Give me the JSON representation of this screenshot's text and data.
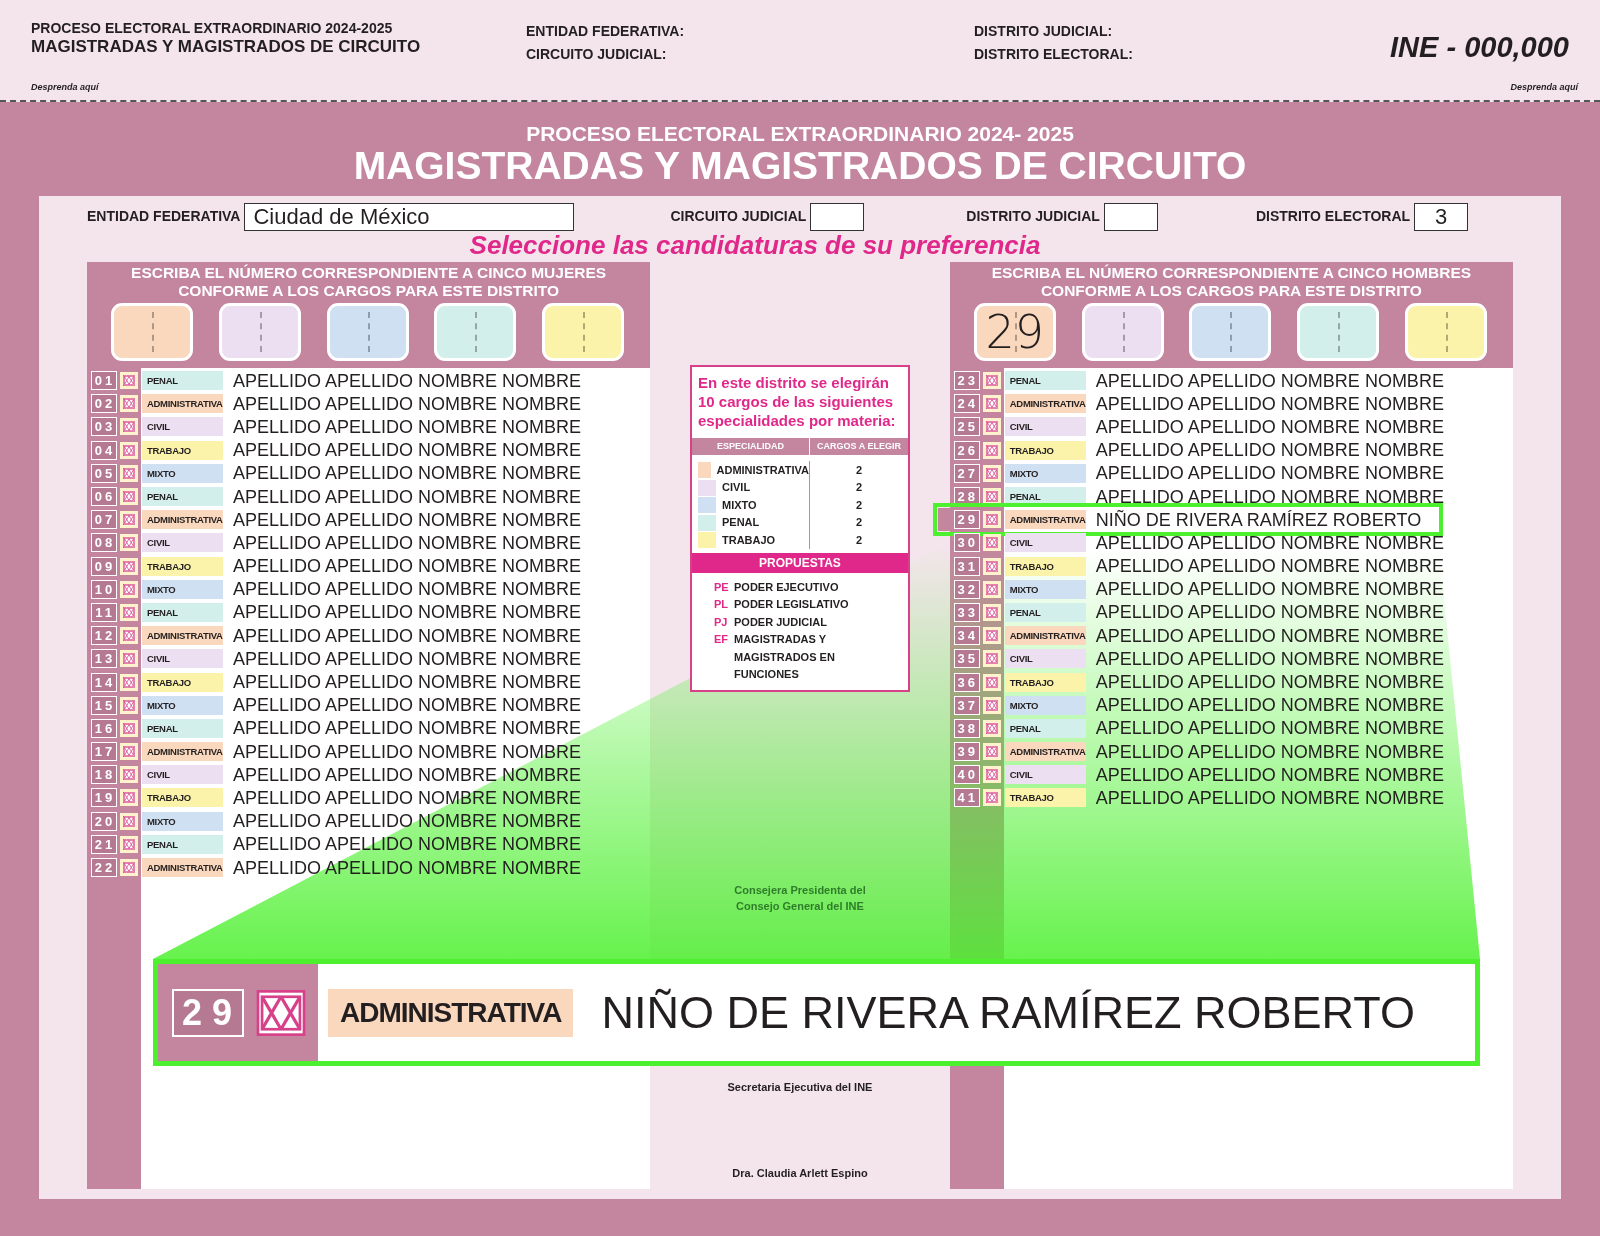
{
  "stub": {
    "election": "PROCESO ELECTORAL EXTRAORDINARIO 2024-2025",
    "title": "MAGISTRADAS Y MAGISTRADOS DE CIRCUITO",
    "detach_left": "Desprenda aquí",
    "labels": [
      "ENTIDAD FEDERATIVA:",
      "CIRCUITO JUDICIAL:",
      "DISTRITO JUDICIAL:",
      "DISTRITO ELECTORAL:"
    ],
    "folio": "INE - 000,000",
    "detach_right": "Desprenda aquí"
  },
  "ballot": {
    "election": "PROCESO ELECTORAL EXTRAORDINARIO 2024- 2025",
    "title": "MAGISTRADAS Y MAGISTRADOS DE CIRCUITO"
  },
  "fields": [
    {
      "label": "ENTIDAD FEDERATIVA",
      "value": "Ciudad de México"
    },
    {
      "label": "CIRCUITO JUDICIAL"
    },
    {
      "label": "DISTRITO JUDICIAL"
    },
    {
      "label": "DISTRITO ELECTORAL",
      "value": "3"
    }
  ],
  "instruction": "Seleccione las candidaturas de su preferencia",
  "panels": [
    {
      "heading": [
        "ESCRIBA EL NÚMERO CORRESPONDIENTE A CINCO MUJERES",
        "CONFORME A LOS CARGOS PARA ESTE DISTRITO"
      ],
      "boxes": [
        {
          "color": "#f9d8bd"
        },
        {
          "color": "#ecdff1"
        },
        {
          "color": "#cfe0f3"
        },
        {
          "color": "#d3efec"
        },
        {
          "color": "#fbf3a9"
        }
      ],
      "rows": [
        {
          "number": "01",
          "specialty": "PENAL",
          "color": "#d3efec",
          "name": "APELLIDO APELLIDO NOMBRE NOMBRE",
          "selected": false
        },
        {
          "number": "02",
          "specialty": "ADMINISTRATIVA",
          "color": "#f9d8bd",
          "name": "APELLIDO APELLIDO NOMBRE NOMBRE",
          "selected": false
        },
        {
          "number": "03",
          "specialty": "CIVIL",
          "color": "#ecdff1",
          "name": "APELLIDO APELLIDO NOMBRE NOMBRE",
          "selected": false
        },
        {
          "number": "04",
          "specialty": "TRABAJO",
          "color": "#fbf3a9",
          "name": "APELLIDO APELLIDO NOMBRE NOMBRE",
          "selected": false
        },
        {
          "number": "05",
          "specialty": "MIXTO",
          "color": "#cfe0f3",
          "name": "APELLIDO APELLIDO NOMBRE NOMBRE",
          "selected": false
        },
        {
          "number": "06",
          "specialty": "PENAL",
          "color": "#d3efec",
          "name": "APELLIDO APELLIDO NOMBRE NOMBRE",
          "selected": false
        },
        {
          "number": "07",
          "specialty": "ADMINISTRATIVA",
          "color": "#f9d8bd",
          "name": "APELLIDO APELLIDO NOMBRE NOMBRE",
          "selected": false
        },
        {
          "number": "08",
          "specialty": "CIVIL",
          "color": "#ecdff1",
          "name": "APELLIDO APELLIDO NOMBRE NOMBRE",
          "selected": false
        },
        {
          "number": "09",
          "specialty": "TRABAJO",
          "color": "#fbf3a9",
          "name": "APELLIDO APELLIDO NOMBRE NOMBRE",
          "selected": false
        },
        {
          "number": "10",
          "specialty": "MIXTO",
          "color": "#cfe0f3",
          "name": "APELLIDO APELLIDO NOMBRE NOMBRE",
          "selected": false
        },
        {
          "number": "11",
          "specialty": "PENAL",
          "color": "#d3efec",
          "name": "APELLIDO APELLIDO NOMBRE NOMBRE",
          "selected": false
        },
        {
          "number": "12",
          "specialty": "ADMINISTRATIVA",
          "color": "#f9d8bd",
          "name": "APELLIDO APELLIDO NOMBRE NOMBRE",
          "selected": false
        },
        {
          "number": "13",
          "specialty": "CIVIL",
          "color": "#ecdff1",
          "name": "APELLIDO APELLIDO NOMBRE NOMBRE",
          "selected": false
        },
        {
          "number": "14",
          "specialty": "TRABAJO",
          "color": "#fbf3a9",
          "name": "APELLIDO APELLIDO NOMBRE NOMBRE",
          "selected": false
        },
        {
          "number": "15",
          "specialty": "MIXTO",
          "color": "#cfe0f3",
          "name": "APELLIDO APELLIDO NOMBRE NOMBRE",
          "selected": false
        },
        {
          "number": "16",
          "specialty": "PENAL",
          "color": "#d3efec",
          "name": "APELLIDO APELLIDO NOMBRE NOMBRE",
          "selected": false
        },
        {
          "number": "17",
          "specialty": "ADMINISTRATIVA",
          "color": "#f9d8bd",
          "name": "APELLIDO APELLIDO NOMBRE NOMBRE",
          "selected": false
        },
        {
          "number": "18",
          "specialty": "CIVIL",
          "color": "#ecdff1",
          "name": "APELLIDO APELLIDO NOMBRE NOMBRE",
          "selected": false
        },
        {
          "number": "19",
          "specialty": "TRABAJO",
          "color": "#fbf3a9",
          "name": "APELLIDO APELLIDO NOMBRE NOMBRE",
          "selected": false
        },
        {
          "number": "20",
          "specialty": "MIXTO",
          "color": "#cfe0f3",
          "name": "APELLIDO APELLIDO NOMBRE NOMBRE",
          "selected": false
        },
        {
          "number": "21",
          "specialty": "PENAL",
          "color": "#d3efec",
          "name": "APELLIDO APELLIDO NOMBRE NOMBRE",
          "selected": false
        },
        {
          "number": "22",
          "specialty": "ADMINISTRATIVA",
          "color": "#f9d8bd",
          "name": "APELLIDO APELLIDO NOMBRE NOMBRE",
          "selected": false
        }
      ]
    },
    {
      "heading": [
        "ESCRIBA EL NÚMERO CORRESPONDIENTE A CINCO HOMBRES",
        "CONFORME A LOS CARGOS PARA ESTE DISTRITO"
      ],
      "boxes": [
        {
          "color": "#f9d8bd",
          "value": "29"
        },
        {
          "color": "#ecdff1"
        },
        {
          "color": "#cfe0f3"
        },
        {
          "color": "#d3efec"
        },
        {
          "color": "#fbf3a9"
        }
      ],
      "rows": [
        {
          "number": "23",
          "specialty": "PENAL",
          "color": "#d3efec",
          "name": "APELLIDO APELLIDO NOMBRE NOMBRE",
          "selected": false
        },
        {
          "number": "24",
          "specialty": "ADMINISTRATIVA",
          "color": "#f9d8bd",
          "name": "APELLIDO APELLIDO NOMBRE NOMBRE",
          "selected": false
        },
        {
          "number": "25",
          "specialty": "CIVIL",
          "color": "#ecdff1",
          "name": "APELLIDO APELLIDO NOMBRE NOMBRE",
          "selected": false
        },
        {
          "number": "26",
          "specialty": "TRABAJO",
          "color": "#fbf3a9",
          "name": "APELLIDO APELLIDO NOMBRE NOMBRE",
          "selected": false
        },
        {
          "number": "27",
          "specialty": "MIXTO",
          "color": "#cfe0f3",
          "name": "APELLIDO APELLIDO NOMBRE NOMBRE",
          "selected": false
        },
        {
          "number": "28",
          "specialty": "PENAL",
          "color": "#d3efec",
          "name": "APELLIDO APELLIDO NOMBRE NOMBRE",
          "selected": false
        },
        {
          "number": "29",
          "specialty": "ADMINISTRATIVA",
          "color": "#f9d8bd",
          "name": "NIÑO DE RIVERA RAMÍREZ ROBERTO",
          "selected": true
        },
        {
          "number": "30",
          "specialty": "CIVIL",
          "color": "#ecdff1",
          "name": "APELLIDO APELLIDO NOMBRE NOMBRE",
          "selected": false
        },
        {
          "number": "31",
          "specialty": "TRABAJO",
          "color": "#fbf3a9",
          "name": "APELLIDO APELLIDO NOMBRE NOMBRE",
          "selected": false
        },
        {
          "number": "32",
          "specialty": "MIXTO",
          "color": "#cfe0f3",
          "name": "APELLIDO APELLIDO NOMBRE NOMBRE",
          "selected": false
        },
        {
          "number": "33",
          "specialty": "PENAL",
          "color": "#d3efec",
          "name": "APELLIDO APELLIDO NOMBRE NOMBRE",
          "selected": false
        },
        {
          "number": "34",
          "specialty": "ADMINISTRATIVA",
          "color": "#f9d8bd",
          "name": "APELLIDO APELLIDO NOMBRE NOMBRE",
          "selected": false
        },
        {
          "number": "35",
          "specialty": "CIVIL",
          "color": "#ecdff1",
          "name": "APELLIDO APELLIDO NOMBRE NOMBRE",
          "selected": false
        },
        {
          "number": "36",
          "specialty": "TRABAJO",
          "color": "#fbf3a9",
          "name": "APELLIDO APELLIDO NOMBRE NOMBRE",
          "selected": false
        },
        {
          "number": "37",
          "specialty": "MIXTO",
          "color": "#cfe0f3",
          "name": "APELLIDO APELLIDO NOMBRE NOMBRE",
          "selected": false
        },
        {
          "number": "38",
          "specialty": "PENAL",
          "color": "#d3efec",
          "name": "APELLIDO APELLIDO NOMBRE NOMBRE",
          "selected": false
        },
        {
          "number": "39",
          "specialty": "ADMINISTRATIVA",
          "color": "#f9d8bd",
          "name": "APELLIDO APELLIDO NOMBRE NOMBRE",
          "selected": false
        },
        {
          "number": "40",
          "specialty": "CIVIL",
          "color": "#ecdff1",
          "name": "APELLIDO APELLIDO NOMBRE NOMBRE",
          "selected": false
        },
        {
          "number": "41",
          "specialty": "TRABAJO",
          "color": "#fbf3a9",
          "name": "APELLIDO APELLIDO NOMBRE NOMBRE",
          "selected": false
        }
      ]
    }
  ],
  "legend": {
    "intro": "En este distrito se elegirán 10 cargos de las siguientes especialidades por materia:",
    "columns": [
      "ESPECIALIDAD",
      "CARGOS A ELEGIR"
    ],
    "rows": [
      {
        "name": "ADMINISTRATIVA",
        "color": "#f9d8bd",
        "count": "2"
      },
      {
        "name": "CIVIL",
        "color": "#ecdff1",
        "count": "2"
      },
      {
        "name": "MIXTO",
        "color": "#cfe0f3",
        "count": "2"
      },
      {
        "name": "PENAL",
        "color": "#d3efec",
        "count": "2"
      },
      {
        "name": "TRABAJO",
        "color": "#fbf3a9",
        "count": "2"
      }
    ],
    "proposals_title": "PROPUESTAS",
    "proposals": [
      {
        "code": "PE",
        "name": "PODER EJECUTIVO"
      },
      {
        "code": "PL",
        "name": "PODER LEGISLATIVO"
      },
      {
        "code": "PJ",
        "name": "PODER JUDICIAL"
      },
      {
        "code": "EF",
        "name": "MAGISTRADAS Y MAGISTRADOS EN FUNCIONES"
      }
    ]
  },
  "signatures": [
    {
      "title": "Consejera Presidenta del Consejo General del INE"
    },
    {
      "title": "Secretaria Ejecutiva del INE",
      "signer": "Dra. Claudia Arlett Espino"
    }
  ],
  "callout": {
    "number": "29",
    "specialty": "ADMINISTRATIVA",
    "color": "#f9d8bd",
    "name": "NIÑO DE RIVERA RAMÍREZ ROBERTO"
  }
}
